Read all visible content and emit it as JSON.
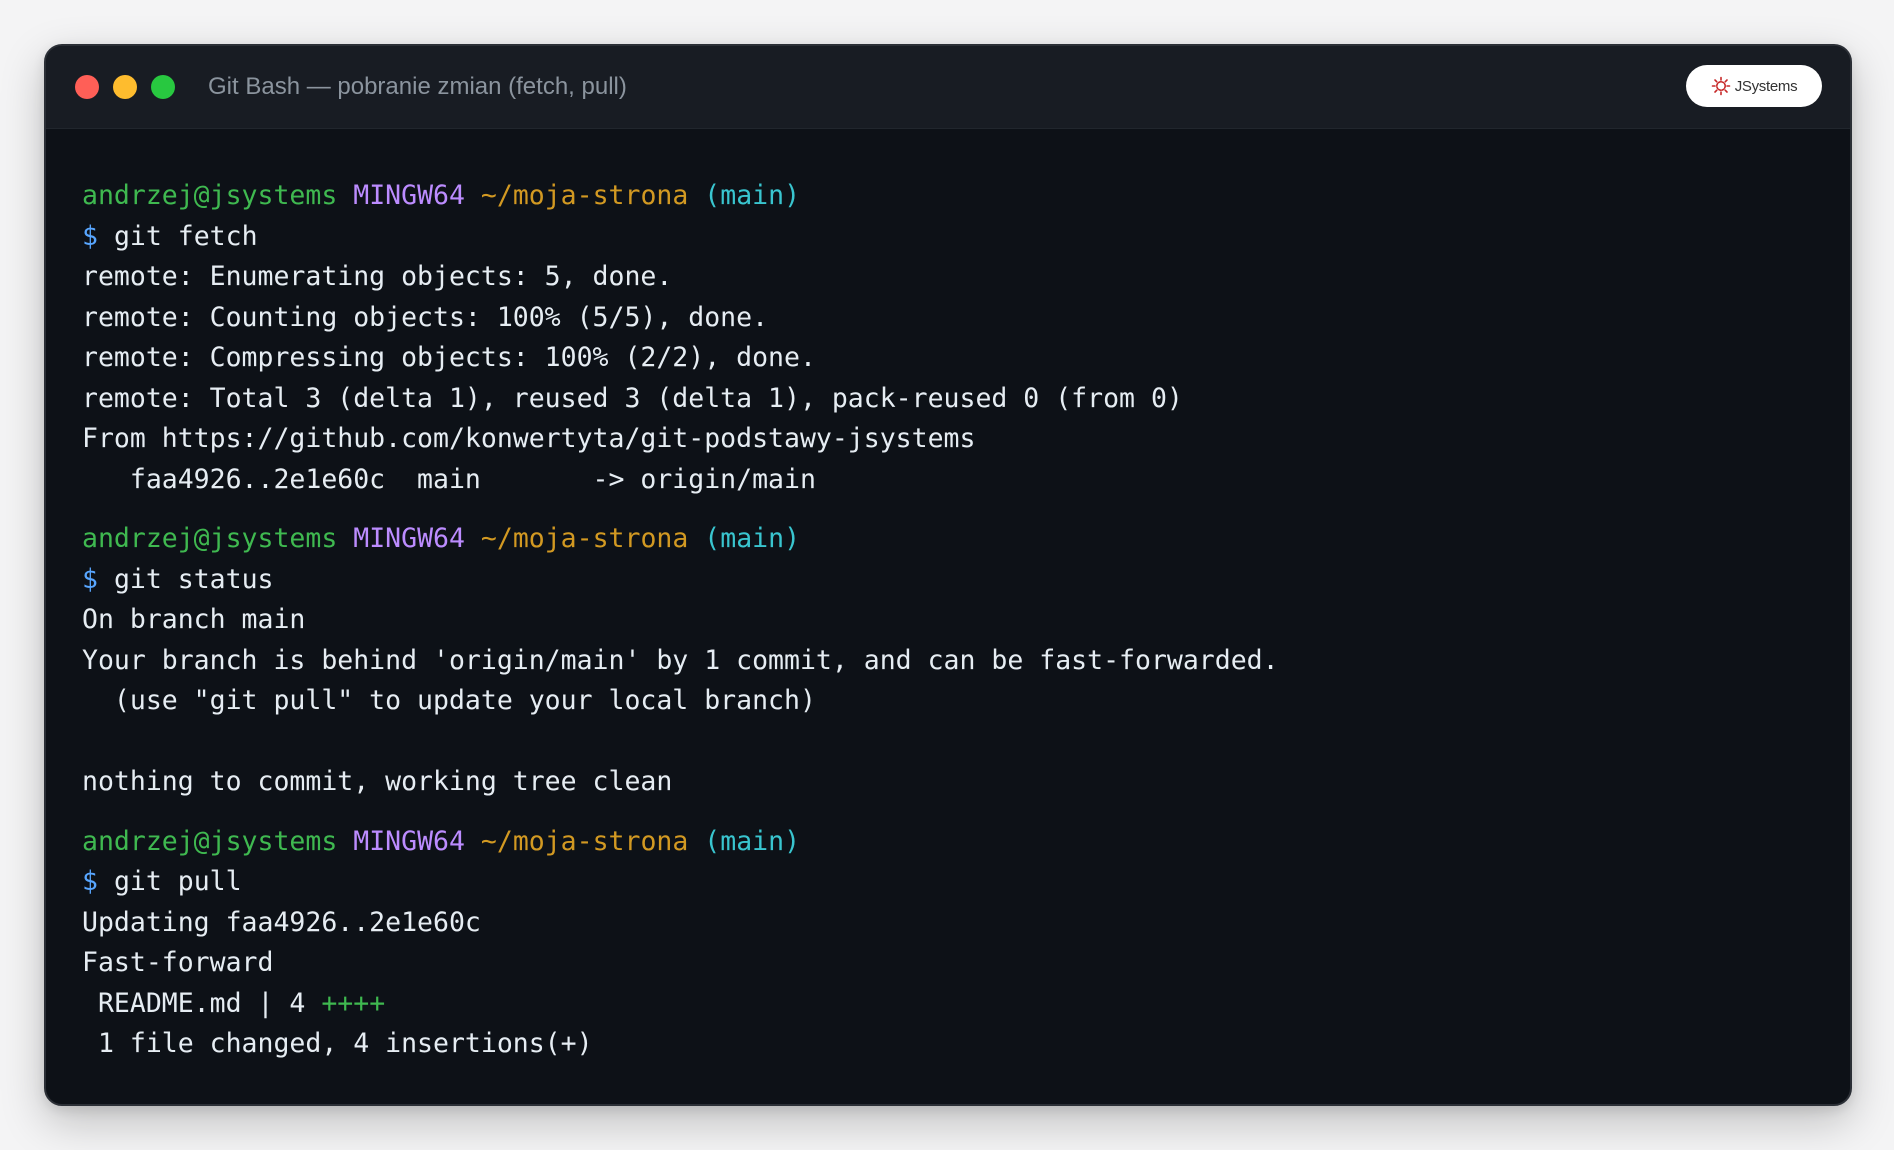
{
  "window": {
    "title": "Git Bash — pobranie zmian (fetch, pull)",
    "logo_text": "JSystems"
  },
  "colors": {
    "user": "#3fb950",
    "host": "#bc8cff",
    "path": "#d29922",
    "branch": "#39c5cf",
    "prompt_symbol": "#58a6ff",
    "insertions": "#3fb950",
    "background": "#0d1117"
  },
  "prompt": {
    "user": "andrzej@jsystems",
    "host": "MINGW64",
    "path": "~/moja-strona",
    "branch": "(main)",
    "symbol": "$"
  },
  "blocks": [
    {
      "command": "git fetch",
      "output": [
        "remote: Enumerating objects: 5, done.",
        "remote: Counting objects: 100% (5/5), done.",
        "remote: Compressing objects: 100% (2/2), done.",
        "remote: Total 3 (delta 1), reused 3 (delta 1), pack-reused 0 (from 0)",
        "From https://github.com/konwertyta/git-podstawy-jsystems",
        "   faa4926..2e1e60c  main       -> origin/main"
      ]
    },
    {
      "command": "git status",
      "output": [
        "On branch main",
        "Your branch is behind 'origin/main' by 1 commit, and can be fast-forwarded.",
        "  (use \"git pull\" to update your local branch)",
        "",
        "nothing to commit, working tree clean"
      ]
    },
    {
      "command": "git pull",
      "output": [
        "Updating faa4926..2e1e60c",
        "Fast-forward"
      ],
      "diffstat": {
        "file": " README.md | 4 ",
        "plus": "++++"
      },
      "summary": " 1 file changed, 4 insertions(+)"
    }
  ]
}
